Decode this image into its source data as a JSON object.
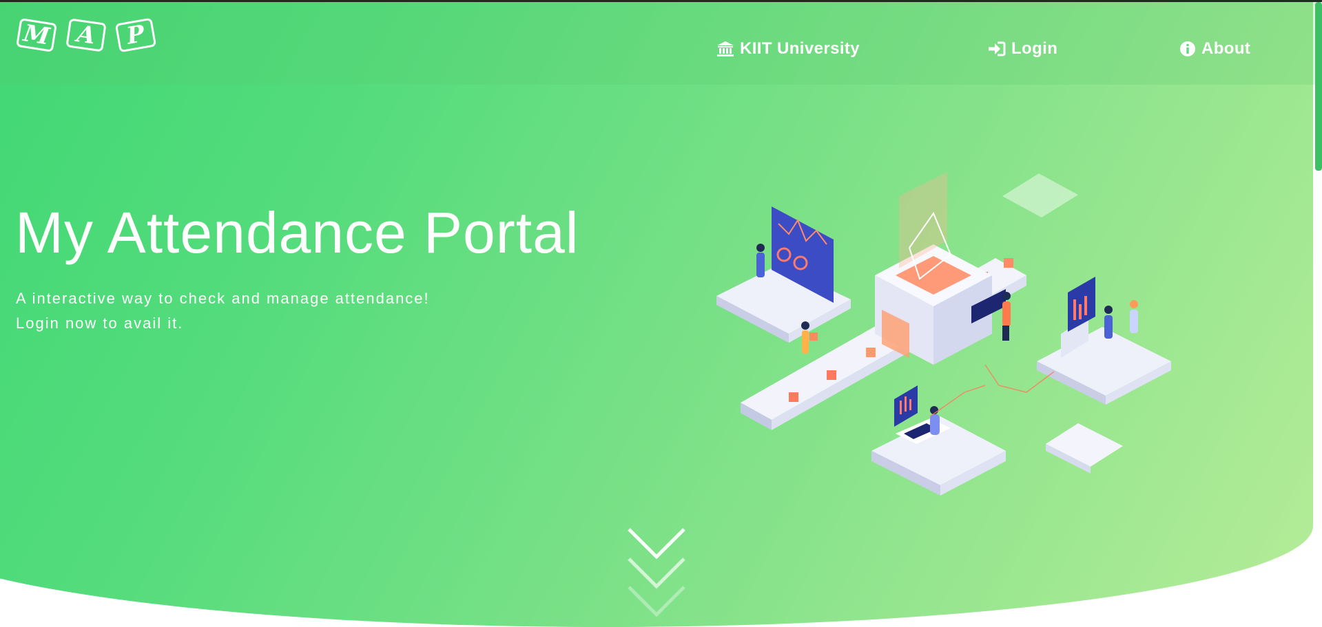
{
  "logo": {
    "letters": [
      "M",
      "A",
      "P"
    ]
  },
  "nav": {
    "university": {
      "label": "KIIT University",
      "icon": "university-icon"
    },
    "login": {
      "label": "Login",
      "icon": "login-icon"
    },
    "about": {
      "label": "About",
      "icon": "info-icon"
    }
  },
  "hero": {
    "title": "My Attendance Portal",
    "subtitle_line1": "A interactive way to check and manage attendance!",
    "subtitle_line2": "Login now to avail it."
  },
  "colors": {
    "gradient_start": "#3dd673",
    "gradient_end": "#b6ec98",
    "scrollbar": "#3cc066",
    "text": "#ffffff"
  },
  "scroll_indicator": {
    "icon": "chevron-down-icon"
  }
}
